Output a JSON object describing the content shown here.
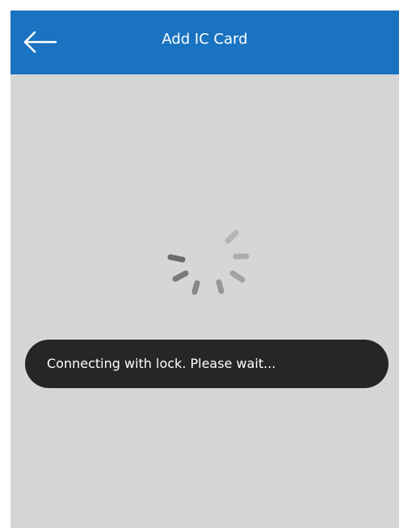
{
  "header": {
    "title": "Add IC Card",
    "back_icon": "arrow-left-icon",
    "background_color": "#1a73c0"
  },
  "body": {
    "background_color": "#d6d6d8",
    "loading_icon": "spinner-icon"
  },
  "toast": {
    "message": "Connecting with lock. Please wait...",
    "background_color": "#262626"
  }
}
